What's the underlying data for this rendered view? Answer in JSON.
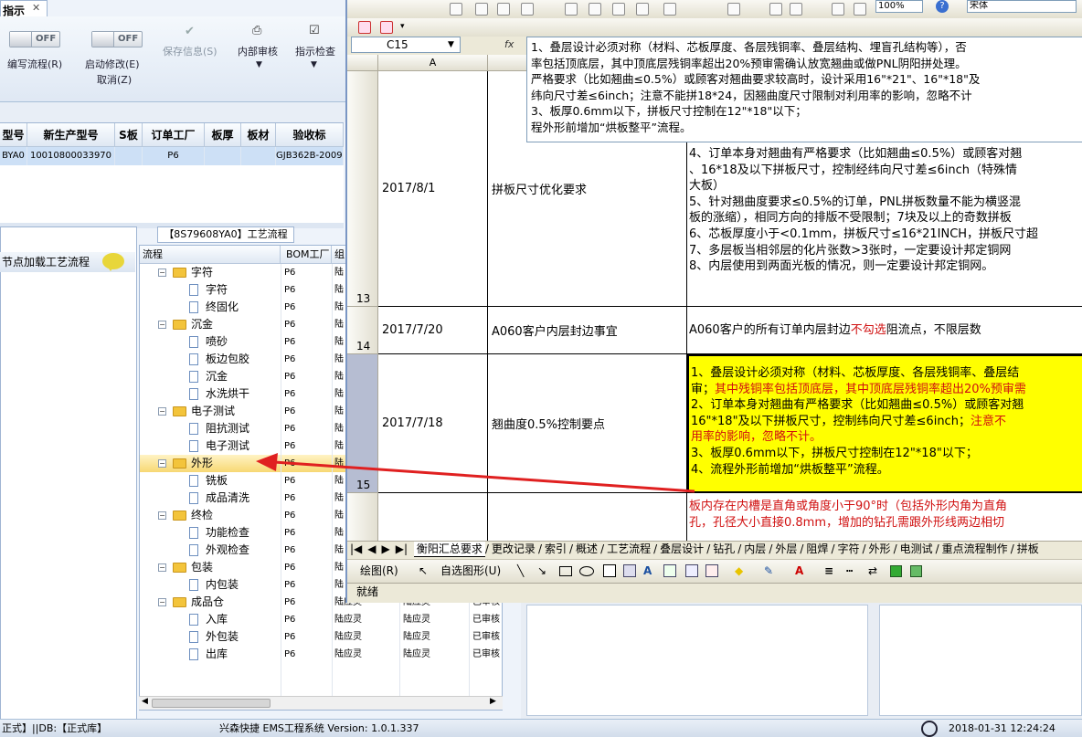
{
  "app": {
    "tab_title": "指示",
    "tab_close": "✕",
    "ribbon": {
      "edit_flow_label": "编写流程(R)",
      "edit_flow_toggle": "OFF",
      "start_modify_label": "启动修改(E)",
      "start_modify_toggle": "OFF",
      "cancel_label": "取消(Z)",
      "save_label": "保存信息(S)",
      "internal_review_label": "内部审核",
      "indicator_check_label": "指示检查"
    },
    "product_grid": {
      "headers": [
        "型号",
        "新生产型号",
        "S板",
        "订单工厂",
        "板厚",
        "板材",
        "验收标"
      ],
      "row": [
        "BYA0",
        "10010800033970",
        "",
        "P6",
        "",
        "",
        "GJB362B-2009"
      ]
    },
    "left_panel_title": "节点加载工艺流程",
    "tree_tab_title": "【8S79608YA0】工艺流程",
    "tree_headers": [
      "流程",
      "BOM工厂",
      "组"
    ],
    "tree": [
      {
        "name": "字符",
        "type": "folder",
        "factory": "P6",
        "c3": "陆",
        "c4": "",
        "c5": ""
      },
      {
        "name": "字符",
        "type": "item",
        "factory": "P6",
        "c3": "陆",
        "c4": "",
        "c5": ""
      },
      {
        "name": "终固化",
        "type": "item",
        "factory": "P6",
        "c3": "陆",
        "c4": "",
        "c5": ""
      },
      {
        "name": "沉金",
        "type": "folder",
        "factory": "P6",
        "c3": "陆",
        "c4": "",
        "c5": ""
      },
      {
        "name": "喷砂",
        "type": "item",
        "factory": "P6",
        "c3": "陆",
        "c4": "",
        "c5": ""
      },
      {
        "name": "板边包胶",
        "type": "item",
        "factory": "P6",
        "c3": "陆",
        "c4": "",
        "c5": ""
      },
      {
        "name": "沉金",
        "type": "item",
        "factory": "P6",
        "c3": "陆",
        "c4": "",
        "c5": ""
      },
      {
        "name": "水洗烘干",
        "type": "item",
        "factory": "P6",
        "c3": "陆",
        "c4": "",
        "c5": ""
      },
      {
        "name": "电子测试",
        "type": "folder",
        "factory": "P6",
        "c3": "陆",
        "c4": "",
        "c5": ""
      },
      {
        "name": "阻抗测试",
        "type": "item",
        "factory": "P6",
        "c3": "陆",
        "c4": "",
        "c5": ""
      },
      {
        "name": "电子测试",
        "type": "item",
        "factory": "P6",
        "c3": "陆",
        "c4": "",
        "c5": ""
      },
      {
        "name": "外形",
        "type": "folder",
        "factory": "P6",
        "c3": "陆",
        "c4": "",
        "c5": "",
        "selected": true
      },
      {
        "name": "铣板",
        "type": "item",
        "factory": "P6",
        "c3": "陆",
        "c4": "",
        "c5": ""
      },
      {
        "name": "成品清洗",
        "type": "item",
        "factory": "P6",
        "c3": "陆",
        "c4": "",
        "c5": ""
      },
      {
        "name": "终检",
        "type": "folder",
        "factory": "P6",
        "c3": "陆",
        "c4": "",
        "c5": ""
      },
      {
        "name": "功能检查",
        "type": "item",
        "factory": "P6",
        "c3": "陆",
        "c4": "",
        "c5": ""
      },
      {
        "name": "外观检查",
        "type": "item",
        "factory": "P6",
        "c3": "陆",
        "c4": "",
        "c5": ""
      },
      {
        "name": "包装",
        "type": "folder",
        "factory": "P6",
        "c3": "陆",
        "c4": "",
        "c5": ""
      },
      {
        "name": "内包装",
        "type": "item",
        "factory": "P6",
        "c3": "陆",
        "c4": "",
        "c5": ""
      },
      {
        "name": "成品仓",
        "type": "folder",
        "factory": "P6",
        "c3": "陆应灵",
        "c4": "陆应灵",
        "c5": "已审核"
      },
      {
        "name": "入库",
        "type": "item",
        "factory": "P6",
        "c3": "陆应灵",
        "c4": "陆应灵",
        "c5": "已审核"
      },
      {
        "name": "外包装",
        "type": "item",
        "factory": "P6",
        "c3": "陆应灵",
        "c4": "陆应灵",
        "c5": "已审核"
      },
      {
        "name": "出库",
        "type": "item",
        "factory": "P6",
        "c3": "陆应灵",
        "c4": "陆应灵",
        "c5": "已审核"
      }
    ],
    "status": {
      "left": "正式】||DB:【正式库】",
      "center": "兴森快捷 EMS工程系统 Version: 1.0.1.337",
      "datetime": "2018-01-31 12:24:24"
    }
  },
  "excel": {
    "zoom": "100%",
    "font_name": "宋体",
    "cell_ref": "C15",
    "fx": "fx",
    "formula_lines": [
      "1、叠层设计必须对称（材料、芯板厚度、各层残铜率、叠层结构、埋盲孔结构等），否",
      "率包括顶底层，其中顶底层残铜率超出20%预审需确认放宽翘曲或做PNL阴阳拼处理。",
      "严格要求（比如翘曲≤0.5%）或顾客对翘曲要求较高时，设计采用16\"*21\"、16\"*18\"及",
      "纬向尺寸差≤6inch；注意不能拼18*24，因翘曲度尺寸限制对利用率的影响，忽略不计",
      "3、板厚0.6mm以下，拼板尺寸控制在12\"*18\"以下；",
      "程外形前增加“烘板整平”流程。"
    ],
    "col_a": "A",
    "rows": [
      {
        "num": "13",
        "date": "2017/8/1",
        "title": "拼板尺寸优化要求",
        "lines": [
          "4、订单本身对翘曲有严格要求（比如翘曲≤0.5%）或顾客对翘",
          "、16*18及以下拼板尺寸，控制经纬向尺寸差≤6inch（特殊情",
          "大板）",
          "5、针对翘曲度要求≤0.5%的订单，PNL拼板数量不能为横竖混",
          "板的涨缩），相同方向的排版不受限制；7块及以上的奇数拼板",
          "6、芯板厚度小于<0.1mm，拼板尺寸≤16*21INCH，拼板尺寸超",
          "7、多层板当相邻层的化片张数>3张时，一定要设计邦定铜网",
          "8、内层使用到两面光板的情况，则一定要设计邦定铜网。"
        ]
      },
      {
        "num": "14",
        "date": "2017/7/20",
        "title": "A060客户内层封边事宜",
        "text_a": "A060客户的所有订单内层封边",
        "text_red": "不勾选",
        "text_b": "阻流点，不限层数"
      },
      {
        "num": "15",
        "date": "2017/7/18",
        "title": "翘曲度0.5%控制要点",
        "l1": "1、叠层设计必须对称（材料、芯板厚度、各层残铜率、叠层结",
        "l2a": "审；",
        "l2b": "其中残铜率包括顶底层，其中顶底层残铜率超出20%预审需",
        "l3": "2、订单本身对翘曲有严格要求（比如翘曲≤0.5%）或顾客对翘",
        "l4a": "16\"*18\"及以下拼板尺寸，控制纬向尺寸差≤6inch；",
        "l4b": "注意不",
        "l5": "用率的影响，忽略不计。",
        "l6": "3、板厚0.6mm以下，拼板尺寸控制在12\"*18\"以下；",
        "l7": "4、流程外形前增加“烘板整平”流程。"
      },
      {
        "num": "",
        "l1": "板内存在内槽是直角或角度小于90°时（包括外形内角为直角",
        "l2": "孔，孔径大小直接0.8mm，增加的钻孔需跟外形线两边相切"
      }
    ],
    "sheet_tabs": [
      "衡阳汇总要求",
      "更改记录",
      "索引",
      "概述",
      "工艺流程",
      "叠层设计",
      "钻孔",
      "内层",
      "外层",
      "阻焊",
      "字符",
      "外形",
      "电测试",
      "重点流程制作",
      "拼板"
    ],
    "draw_label": "绘图(R)",
    "autoshape_label": "自选图形(U)",
    "status_ready": "就绪"
  },
  "colors": {
    "highlight_yellow": "#ffff00",
    "red_text": "#d01010",
    "arrow_red": "#e02020",
    "selection_gold": "#f7d873"
  }
}
